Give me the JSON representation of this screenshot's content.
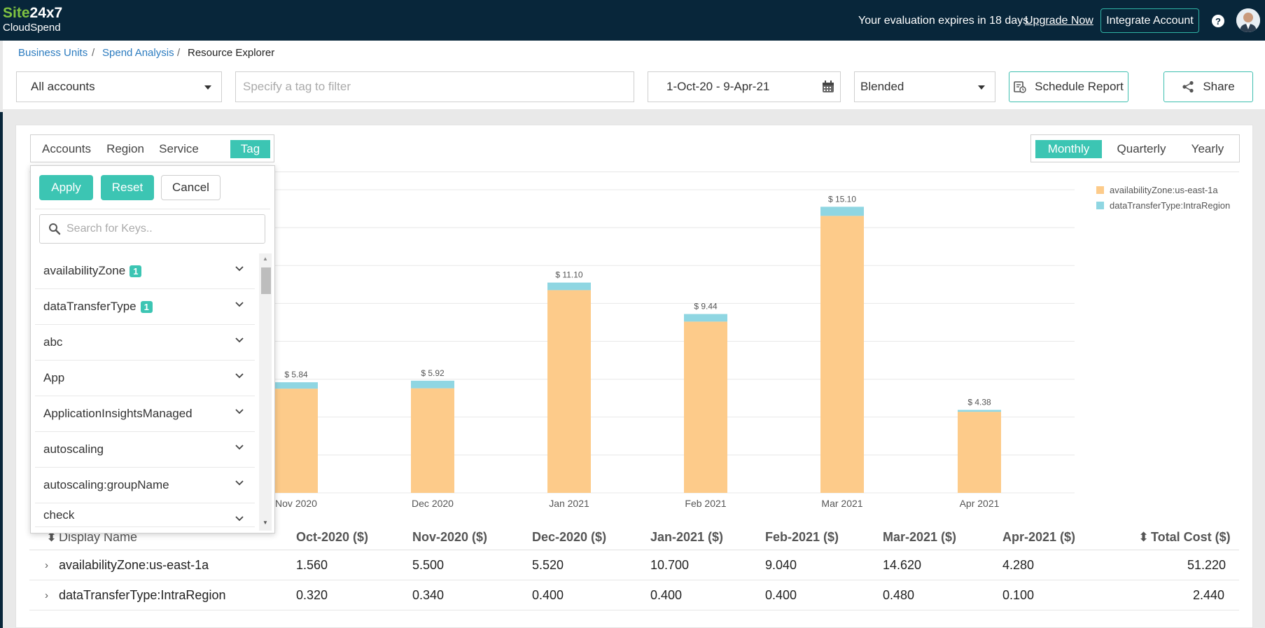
{
  "app": {
    "brand_site": "Site",
    "brand_rest": "24x7",
    "subtitle": "CloudSpend",
    "eval_text": "Your evaluation expires in 18 days",
    "upgrade_label": "Upgrade Now",
    "integrate_label": "Integrate Account",
    "help_label": "?"
  },
  "breadcrumb": {
    "items": [
      "Business Units",
      "Spend Analysis",
      "Resource Explorer"
    ],
    "separator": "/"
  },
  "filters": {
    "accounts_value": "All accounts",
    "tag_placeholder": "Specify a tag to filter",
    "date_range": "1-Oct-20 - 9-Apr-21",
    "cost_type": "Blended",
    "schedule_label": "Schedule Report",
    "share_label": "Share"
  },
  "group_tabs": [
    "Accounts",
    "Region",
    "Service",
    "Tag"
  ],
  "group_active": "Tag",
  "period_tabs": [
    "Monthly",
    "Quarterly",
    "Yearly"
  ],
  "period_active": "Monthly",
  "tag_panel": {
    "apply_label": "Apply",
    "reset_label": "Reset",
    "cancel_label": "Cancel",
    "search_placeholder": "Search for Keys..",
    "keys": [
      {
        "name": "availabilityZone",
        "badge": "1"
      },
      {
        "name": "dataTransferType",
        "badge": "1"
      },
      {
        "name": "abc",
        "badge": ""
      },
      {
        "name": "App",
        "badge": ""
      },
      {
        "name": "ApplicationInsightsManaged",
        "badge": ""
      },
      {
        "name": "autoscaling",
        "badge": ""
      },
      {
        "name": "autoscaling:groupName",
        "badge": ""
      },
      {
        "name": "check",
        "badge": ""
      }
    ]
  },
  "colors": {
    "series1": "#fdcb8a",
    "series2": "#8fd6e2",
    "accent": "#3cc5b3",
    "topbar": "#08263a"
  },
  "chart_data": {
    "type": "bar",
    "stacked": true,
    "categories": [
      "Nov 2020",
      "Dec 2020",
      "Jan 2021",
      "Feb 2021",
      "Mar 2021",
      "Apr 2021"
    ],
    "series": [
      {
        "name": "availabilityZone:us-east-1a",
        "values": [
          5.5,
          5.52,
          10.7,
          9.04,
          14.62,
          4.28
        ]
      },
      {
        "name": "dataTransferType:IntraRegion",
        "values": [
          0.34,
          0.4,
          0.4,
          0.4,
          0.48,
          0.1
        ]
      }
    ],
    "totals": [
      "$ 5.84",
      "$ 5.92",
      "$ 11.10",
      "$ 9.44",
      "$ 15.10",
      "$ 4.38"
    ],
    "ylim": [
      0,
      16
    ],
    "grid": true,
    "legend": "top-right"
  },
  "table": {
    "columns": [
      "Display Name",
      "Oct-2020 ($)",
      "Nov-2020 ($)",
      "Dec-2020 ($)",
      "Jan-2021 ($)",
      "Feb-2021 ($)",
      "Mar-2021 ($)",
      "Apr-2021 ($)",
      "Total Cost ($)"
    ],
    "rows": [
      [
        "availabilityZone:us-east-1a",
        "1.560",
        "5.500",
        "5.520",
        "10.700",
        "9.040",
        "14.620",
        "4.280",
        "51.220"
      ],
      [
        "dataTransferType:IntraRegion",
        "0.320",
        "0.340",
        "0.400",
        "0.400",
        "0.400",
        "0.480",
        "0.100",
        "2.440"
      ]
    ]
  }
}
